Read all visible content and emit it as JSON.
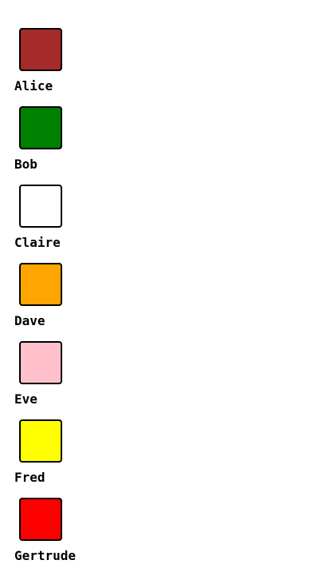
{
  "people": [
    {
      "name": "Alice",
      "color": "#a52a2a"
    },
    {
      "name": "Bob",
      "color": "#008000"
    },
    {
      "name": "Claire",
      "color": "#ffffff"
    },
    {
      "name": "Dave",
      "color": "#ffa500"
    },
    {
      "name": "Eve",
      "color": "#ffc0cb"
    },
    {
      "name": "Fred",
      "color": "#ffff00"
    },
    {
      "name": "Gertrude",
      "color": "#ff0000"
    }
  ]
}
